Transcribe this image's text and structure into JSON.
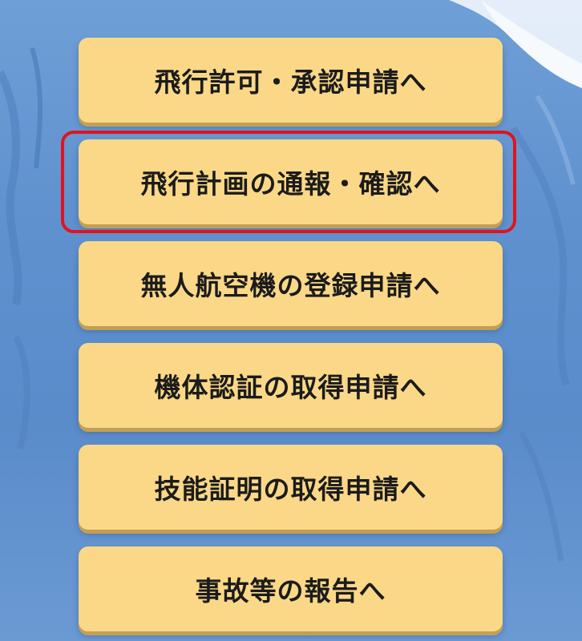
{
  "menu": {
    "items": [
      {
        "label": "飛行許可・承認申請へ"
      },
      {
        "label": "飛行計画の通報・確認へ"
      },
      {
        "label": "無人航空機の登録申請へ"
      },
      {
        "label": "機体認証の取得申請へ"
      },
      {
        "label": "技能証明の取得申請へ"
      },
      {
        "label": "事故等の報告へ"
      }
    ],
    "highlighted_index": 1
  },
  "colors": {
    "button_fill": "#fbd887",
    "button_shadow": "#d6a646",
    "highlight_border": "#e0141e",
    "background": "#5f91cf"
  }
}
